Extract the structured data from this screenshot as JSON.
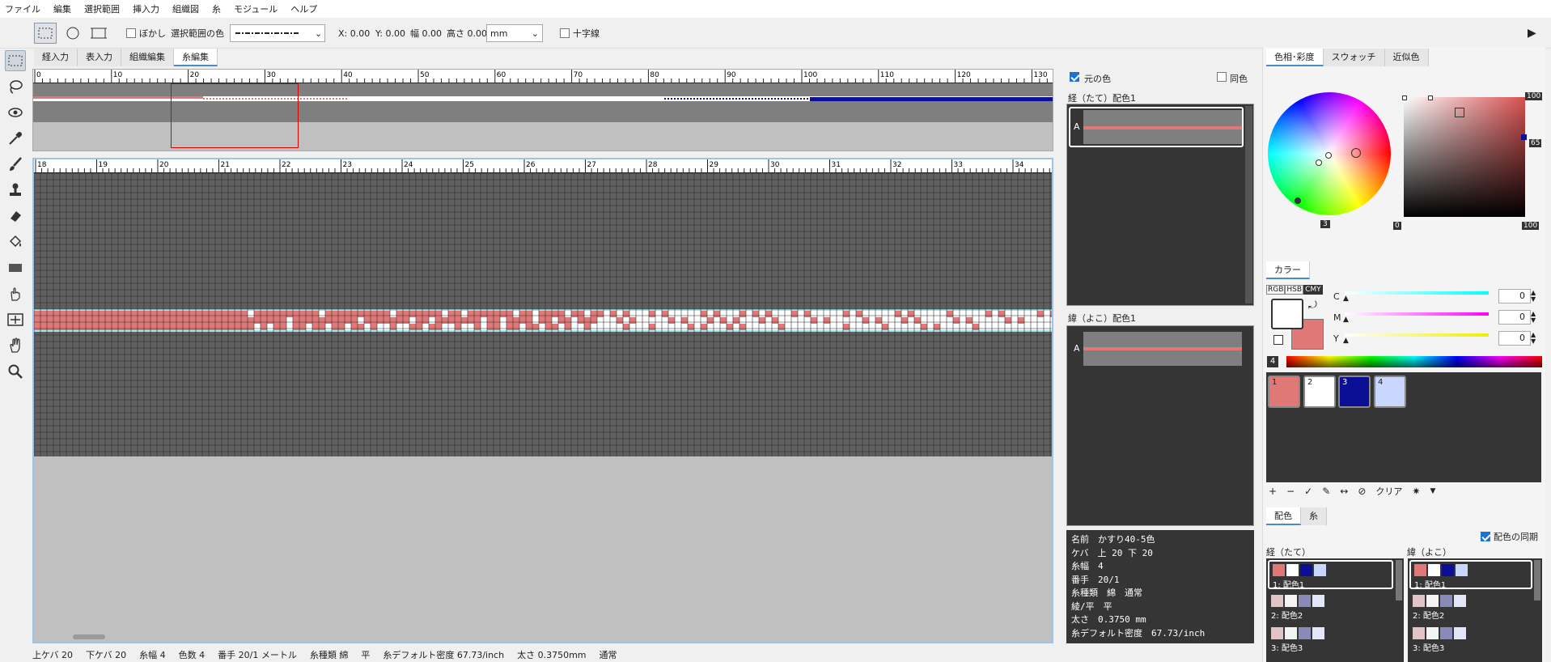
{
  "menu": [
    "ファイル",
    "編集",
    "選択範囲",
    "挿入力",
    "組織図",
    "糸",
    "モジュール",
    "ヘルプ"
  ],
  "toolbar": {
    "blur_label": "ぼかし",
    "sel_color_label": "選択範囲の色",
    "x": "X: 0.00",
    "y": "Y: 0.00",
    "width": "幅 0.00",
    "height": "高さ 0.00",
    "unit": "mm",
    "crosshair_label": "十字線"
  },
  "tabs": [
    "経入力",
    "表入力",
    "組織編集",
    "糸編集"
  ],
  "active_tab": "糸編集",
  "top_ruler": [
    "0",
    "10",
    "20",
    "30",
    "40",
    "50",
    "60",
    "70",
    "80",
    "90",
    "100",
    "110",
    "120",
    "130"
  ],
  "main_ruler": [
    "18",
    "19",
    "20",
    "21",
    "22",
    "23",
    "24",
    "25",
    "26",
    "27",
    "28",
    "29",
    "30",
    "31",
    "32",
    "33",
    "34"
  ],
  "colors": {
    "pink": "#e07878",
    "white": "#ffffff",
    "navy": "#0a0f96",
    "light": "#c9d7ff",
    "grid_bg": "#5f5f5f",
    "panel": "#353535"
  },
  "mid_panel": {
    "orig_color": "元の色",
    "same_color": "同色",
    "warp_label": "経（たて）配色1",
    "weft_label": "緯（よこ）配色1",
    "row_letter": "A"
  },
  "info": {
    "name": "名前　かすり40-5色",
    "kebaw": "ケバ　上 20 下 20",
    "itohaba": "糸幅　4",
    "bante": "番手　20/1",
    "itoshurui": "糸種類　綿　通常",
    "aya": "綾/平　平",
    "futosa": "太さ　0.3750 mm",
    "density": "糸デフォルト密度　67.73/inch"
  },
  "right": {
    "tabs": [
      "色相･彩度",
      "スウォッチ",
      "近似色"
    ],
    "wheel_value": "3",
    "square_top": "100",
    "square_right": "65",
    "square_bl": "0",
    "square_br": "100",
    "color_tab": "カラー",
    "modes": [
      "RGB",
      "HSB",
      "CMY"
    ],
    "sliders": [
      {
        "label": "C",
        "value": "0"
      },
      {
        "label": "M",
        "value": "0"
      },
      {
        "label": "Y",
        "value": "0"
      }
    ],
    "spectrum_num": "4",
    "swatches": [
      "1",
      "2",
      "3",
      "4"
    ],
    "clear_label": "クリア",
    "bottom_tabs": [
      "配色",
      "糸"
    ],
    "sync_label": "配色の同期",
    "warp_col": "経（たて）",
    "weft_col": "緯（よこ）",
    "palettes": [
      "1: 配色1",
      "2: 配色2",
      "3: 配色3"
    ]
  },
  "status": {
    "top_keba": "上ケバ 20",
    "bottom_keba": "下ケバ 20",
    "itohaba": "糸幅 4",
    "colors": "色数 4",
    "bante": "番手 20/1 メートル",
    "kind": "糸種類 綿",
    "weave": "平",
    "density": "糸デフォルト密度 67.73/inch",
    "thick": "太さ 0.3750mm",
    "normal": "通常"
  }
}
